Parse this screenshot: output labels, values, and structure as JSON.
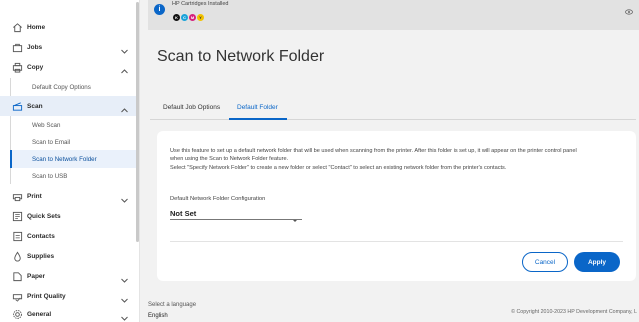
{
  "sidebar": {
    "items": [
      {
        "label": "Home",
        "icon": "home-icon"
      },
      {
        "label": "Jobs",
        "icon": "jobs-icon"
      },
      {
        "label": "Copy",
        "icon": "copy-icon"
      },
      {
        "label": "Scan",
        "icon": "scan-icon"
      },
      {
        "label": "Print",
        "icon": "print-icon"
      },
      {
        "label": "Quick Sets",
        "icon": "quick-sets-icon"
      },
      {
        "label": "Contacts",
        "icon": "contacts-icon"
      },
      {
        "label": "Supplies",
        "icon": "supplies-icon"
      },
      {
        "label": "Paper",
        "icon": "paper-icon"
      },
      {
        "label": "Print Quality",
        "icon": "print-quality-icon"
      },
      {
        "label": "General",
        "icon": "general-icon"
      }
    ],
    "copy_subitems": [
      "Default Copy Options"
    ],
    "scan_subitems": [
      "Web Scan",
      "Scan to Email",
      "Scan to Network Folder",
      "Scan to USB"
    ]
  },
  "notification": {
    "text": "HP Cartridges Installed",
    "cartridges": [
      {
        "letter": "K",
        "color": "#111111"
      },
      {
        "letter": "C",
        "color": "#1aa3d9"
      },
      {
        "letter": "M",
        "color": "#d6217d"
      },
      {
        "letter": "Y",
        "color": "#f2c200"
      }
    ]
  },
  "main": {
    "title": "Scan to Network Folder",
    "tabs": [
      "Default Job Options",
      "Default Folder"
    ],
    "description": [
      "Use this feature to set up a default network folder that will be used when scanning from the printer. After this folder is set up, it will appear on the printer control panel",
      "when using the Scan to Network Folder feature.",
      "Select \"Specify Network Folder\" to create a new folder or select \"Contact\" to select an existing network folder from the printer's contacts."
    ],
    "field_label": "Default Network Folder Configuration",
    "field_value": "Not Set",
    "cancel_label": "Cancel",
    "apply_label": "Apply"
  },
  "footer": {
    "language_label": "Select a language",
    "language_value": "English",
    "copyright": "© Copyright 2010-2023 HP Development Company, L"
  },
  "colors": {
    "accent": "#0a66c8",
    "selected_bg": "#e7eef8"
  }
}
